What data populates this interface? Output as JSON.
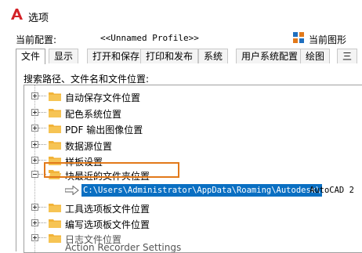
{
  "window": {
    "title": "选项"
  },
  "profile": {
    "label": "当前配置:",
    "value": "<<Unnamed Profile>>",
    "right_label": "当前图形"
  },
  "tabs": [
    {
      "label": "文件",
      "active": true
    },
    {
      "label": "显示"
    },
    {
      "label": "打开和保存"
    },
    {
      "label": "打印和发布"
    },
    {
      "label": "系统"
    },
    {
      "label": "用户系统配置"
    },
    {
      "label": "绘图"
    },
    {
      "label": "三"
    }
  ],
  "section_label": "搜索路径、文件名和文件位置:",
  "tree": {
    "items": [
      {
        "label": "自动保存文件位置"
      },
      {
        "label": "配色系统位置"
      },
      {
        "label": "PDF 输出图像位置"
      },
      {
        "label": "数据源位置"
      },
      {
        "label": "样板设置"
      },
      {
        "label": "块最近的文件夹位置",
        "expanded": true,
        "highlighted": true
      },
      {
        "label": "工具选项板文件位置"
      },
      {
        "label": "编写选项板文件位置"
      },
      {
        "label": "日志文件位置"
      },
      {
        "label": "Action Recorder Settings"
      }
    ],
    "child_path_selected": "C:\\Users\\Administrator\\AppData\\Roaming\\Autodesk\\",
    "child_path_rest": "AutoCAD 2"
  },
  "colors": {
    "accent": "#e2791a",
    "selection": "#0a6fc2",
    "folder": "#f2b338"
  }
}
